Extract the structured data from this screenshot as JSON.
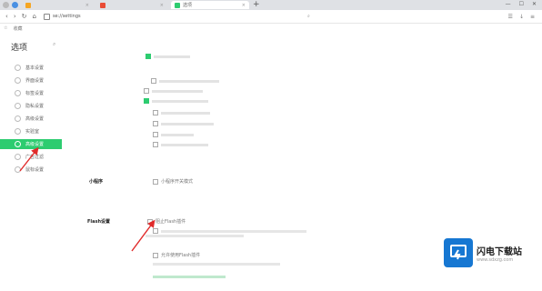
{
  "browser": {
    "tabs": [
      {
        "title": "",
        "active": false
      },
      {
        "title": "",
        "active": false
      },
      {
        "title": "选项",
        "active": true
      }
    ],
    "new_tab": "+",
    "address": "se://settings",
    "bookmarks_label": "收藏"
  },
  "sidebar": {
    "title": "选项",
    "items": [
      {
        "label": "基本设置"
      },
      {
        "label": "界面设置"
      },
      {
        "label": "标签设置"
      },
      {
        "label": "隐私设置"
      },
      {
        "label": "高级设置"
      },
      {
        "label": "实验室"
      },
      {
        "label": "高级设置"
      },
      {
        "label": "广告过滤"
      },
      {
        "label": "鼠标设置"
      }
    ]
  },
  "main": {
    "section_small": "小程序",
    "small_option": "小程序开关模式",
    "section_flash": "Flash设置",
    "flash_option": "阻止Flash插件",
    "flash_sub": "允许使用Flash插件"
  },
  "watermark": {
    "name": "闪电下载站",
    "url": "www.sdxzg.com"
  },
  "colors": {
    "accent": "#2dcc70",
    "arrow": "#e02a2a",
    "logo": "#1677d2"
  }
}
